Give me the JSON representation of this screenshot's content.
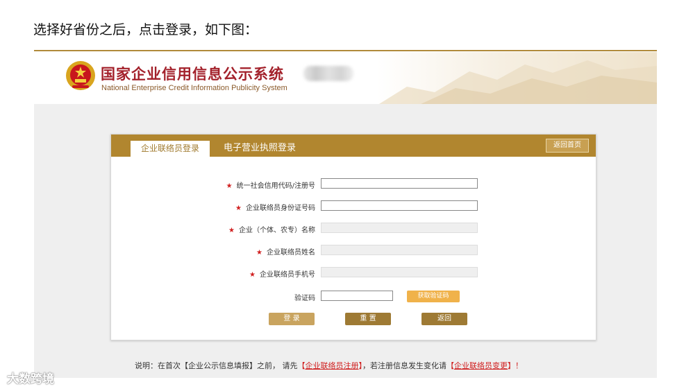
{
  "caption": "选择好省份之后，点击登录，如下图：",
  "site": {
    "title": "国家企业信用信息公示系统",
    "subtitle": "National Enterprise Credit Information Publicity System"
  },
  "tabs": {
    "active": "企业联络员登录",
    "inactive": "电子营业执照登录"
  },
  "back_home_label": "返回首页",
  "form": {
    "fields": [
      {
        "label": "统一社会信用代码/注册号",
        "required": true,
        "value": "",
        "disabled": false
      },
      {
        "label": "企业联络员身份证号码",
        "required": true,
        "value": "",
        "disabled": false
      },
      {
        "label": "企业（个体、农专）名称",
        "required": true,
        "value": "",
        "disabled": true
      },
      {
        "label": "企业联络员姓名",
        "required": true,
        "value": "",
        "disabled": true
      },
      {
        "label": "企业联络员手机号",
        "required": true,
        "value": "",
        "disabled": true
      }
    ],
    "captcha_label": "验证码",
    "get_code_label": "获取验证码",
    "required_mark": "★"
  },
  "buttons": {
    "login": "登 录",
    "reset": "重 置",
    "back": "返回"
  },
  "note": {
    "prefix": "说明：在首次【企业公示信息填报】之前， 请先",
    "link1": "企业联络员注册",
    "middle": "，若注册信息发生变化请",
    "link2": "企业联络员变更",
    "suffix": "！",
    "open_bracket": "【",
    "close_bracket": "】"
  },
  "watermark": "大数跨境",
  "colors": {
    "gold": "#b1862f",
    "title_red": "#a3212b",
    "required_red": "#d01f1f",
    "code_button": "#f0b24a"
  }
}
